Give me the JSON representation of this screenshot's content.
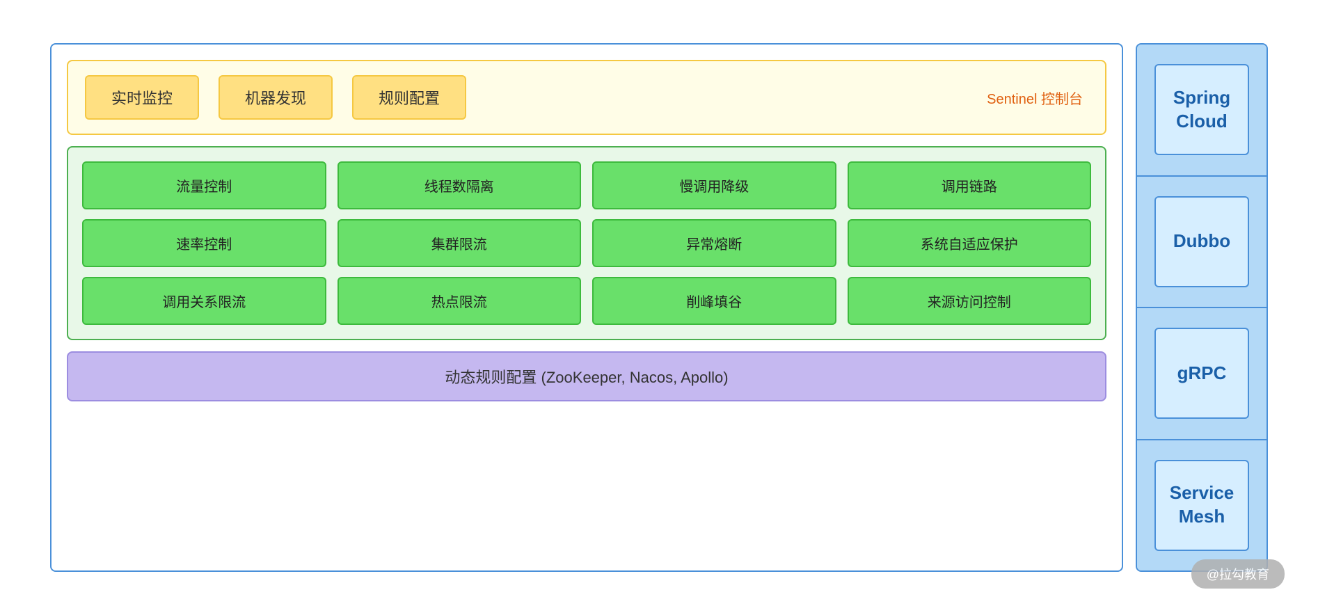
{
  "sentinel": {
    "boxes": [
      "实时监控",
      "机器发现",
      "规则配置"
    ],
    "label": "Sentinel 控制台"
  },
  "green_grid": {
    "rows": [
      [
        "流量控制",
        "线程数隔离",
        "慢调用降级",
        "调用链路"
      ],
      [
        "速率控制",
        "集群限流",
        "异常熔断",
        "系统自适应保护"
      ],
      [
        "调用关系限流",
        "热点限流",
        "削峰填谷",
        "来源访问控制"
      ]
    ]
  },
  "dynamic_config": "动态规则配置 (ZooKeeper, Nacos, Apollo)",
  "sidebar": {
    "items": [
      "Spring\nCloud",
      "Dubbo",
      "gRPC",
      "Service\nMesh"
    ]
  },
  "watermark": "@拉勾教育"
}
